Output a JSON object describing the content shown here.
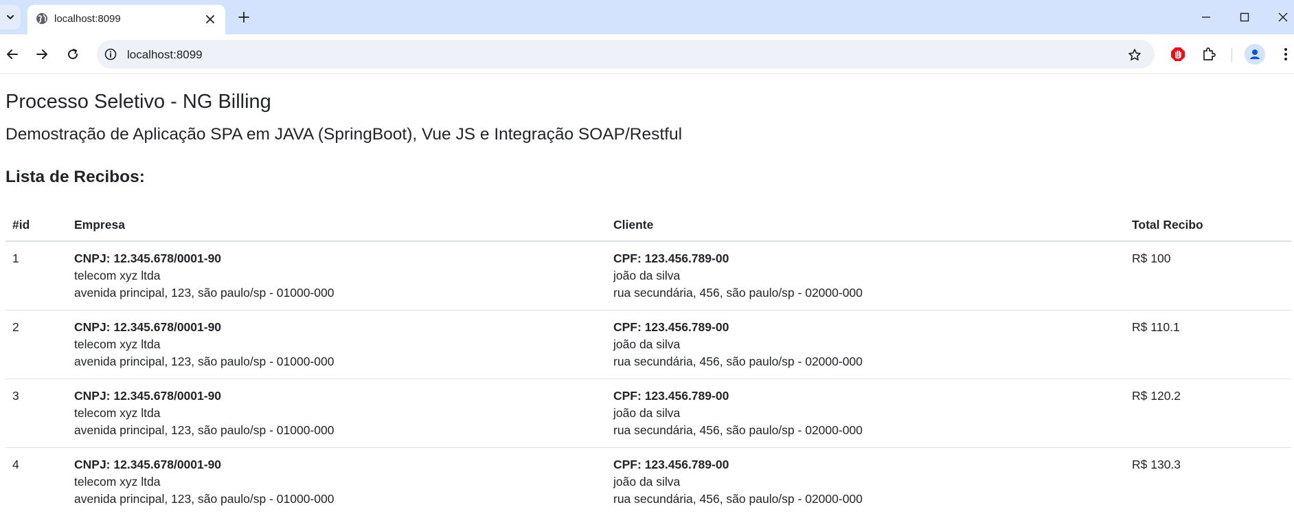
{
  "browser": {
    "tab_title": "localhost:8099",
    "url": "localhost:8099"
  },
  "page": {
    "title": "Processo Seletivo - NG Billing",
    "subtitle": "Demostração de Aplicação SPA em JAVA (SpringBoot), Vue JS e Integração SOAP/Restful",
    "list_heading": "Lista de Recibos:"
  },
  "table": {
    "headers": [
      "#id",
      "Empresa",
      "Cliente",
      "Total Recibo"
    ],
    "rows": [
      {
        "id": "1",
        "empresa": {
          "cnpj": "CNPJ: 12.345.678/0001-90",
          "nome": "telecom xyz ltda",
          "endereco": "avenida principal, 123, são paulo/sp - 01000-000"
        },
        "cliente": {
          "cpf": "CPF: 123.456.789-00",
          "nome": "joão da silva",
          "endereco": "rua secundária, 456, são paulo/sp - 02000-000"
        },
        "total": "R$ 100"
      },
      {
        "id": "2",
        "empresa": {
          "cnpj": "CNPJ: 12.345.678/0001-90",
          "nome": "telecom xyz ltda",
          "endereco": "avenida principal, 123, são paulo/sp - 01000-000"
        },
        "cliente": {
          "cpf": "CPF: 123.456.789-00",
          "nome": "joão da silva",
          "endereco": "rua secundária, 456, são paulo/sp - 02000-000"
        },
        "total": "R$ 110.1"
      },
      {
        "id": "3",
        "empresa": {
          "cnpj": "CNPJ: 12.345.678/0001-90",
          "nome": "telecom xyz ltda",
          "endereco": "avenida principal, 123, são paulo/sp - 01000-000"
        },
        "cliente": {
          "cpf": "CPF: 123.456.789-00",
          "nome": "joão da silva",
          "endereco": "rua secundária, 456, são paulo/sp - 02000-000"
        },
        "total": "R$ 120.2"
      },
      {
        "id": "4",
        "empresa": {
          "cnpj": "CNPJ: 12.345.678/0001-90",
          "nome": "telecom xyz ltda",
          "endereco": "avenida principal, 123, são paulo/sp - 01000-000"
        },
        "cliente": {
          "cpf": "CPF: 123.456.789-00",
          "nome": "joão da silva",
          "endereco": "rua secundária, 456, são paulo/sp - 02000-000"
        },
        "total": "R$ 130.3"
      }
    ]
  },
  "icons": {
    "tab_search": "chevron-down-icon",
    "favicon": "globe-icon",
    "tab_close": "close-icon",
    "new_tab": "plus-icon",
    "minimize": "minimize-icon",
    "maximize": "maximize-icon",
    "window_close": "close-icon",
    "back": "arrow-left-icon",
    "forward": "arrow-right-icon",
    "reload": "reload-icon",
    "site_info": "info-icon",
    "bookmark": "star-icon",
    "adblock": "stop-hand-icon",
    "extensions": "puzzle-icon",
    "profile": "person-icon",
    "menu": "kebab-menu-icon"
  },
  "colors": {
    "tabstrip": "#d3e3fd",
    "omnibox": "#eef1f8",
    "text": "#212529",
    "border": "#dee2e6",
    "adblock_red": "#e8101a",
    "profile_blue": "#0b57d0"
  }
}
